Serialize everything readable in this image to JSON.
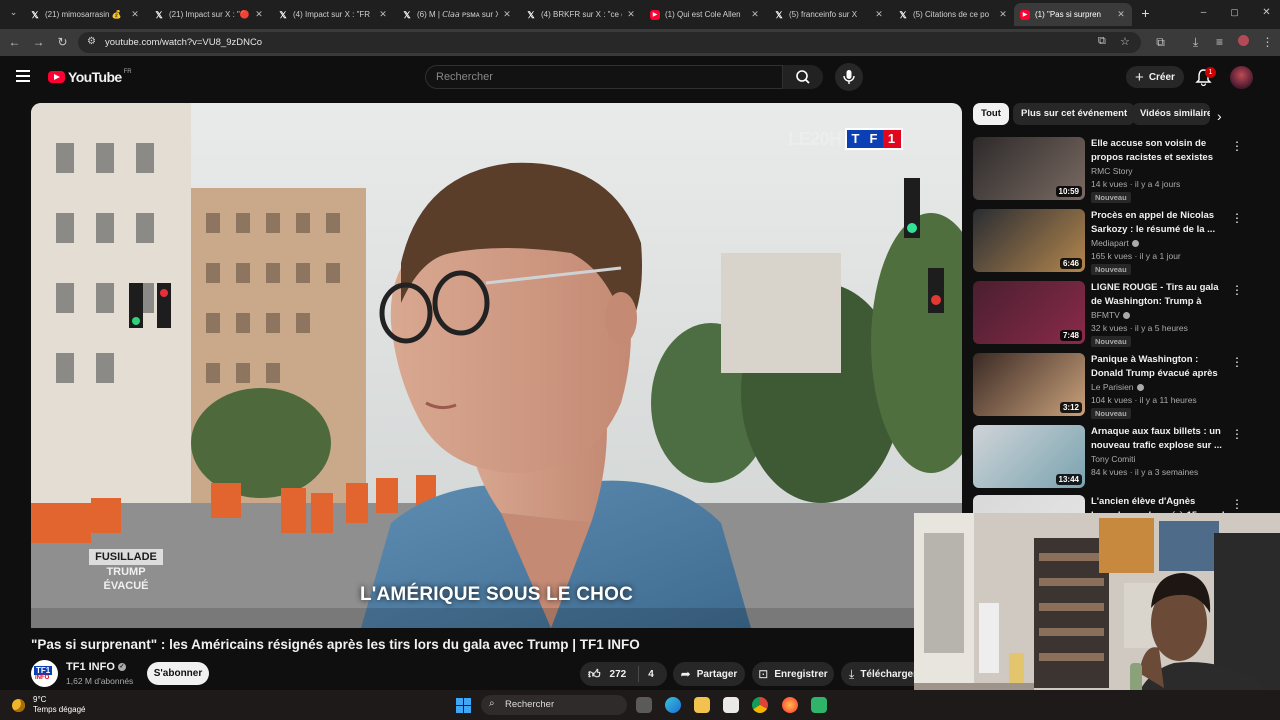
{
  "browser": {
    "tabs": [
      {
        "icon": "x",
        "title": "(21) mimosarrasin 💰"
      },
      {
        "icon": "x",
        "title": "(21) Impact sur X : \"🔴"
      },
      {
        "icon": "x",
        "title": "(4) Impact sur X : \"FR"
      },
      {
        "icon": "x",
        "title": "(6) M | 𝘊𝘭𝘢𝘢 ᴘsᴍᴀ sur X"
      },
      {
        "icon": "x",
        "title": "(4) BRKFR sur X : \"ce q"
      },
      {
        "icon": "yt",
        "title": "(1) Qui est Cole Allen"
      },
      {
        "icon": "x",
        "title": "(5) franceinfo sur X"
      },
      {
        "icon": "x",
        "title": "(5) Citations de ce po"
      },
      {
        "icon": "yt",
        "title": "(1) \"Pas si surpren"
      }
    ],
    "url": "youtube.com/watch?v=VU8_9zDNCo"
  },
  "youtube": {
    "logo_text": "YouTube",
    "country": "FR",
    "search_placeholder": "Rechercher",
    "create_label": "Créer",
    "notification_count": "1"
  },
  "video": {
    "overlay_logo_prefix": "LE20H",
    "overlay_logo_letters": [
      "T",
      "F",
      "1"
    ],
    "banner_top": "FUSILLADE",
    "banner_line1": "TRUMP",
    "banner_line2": "ÉVACUÉ",
    "caption": "L'AMÉRIQUE SOUS LE CHOC",
    "title": "\"Pas si surprenant\" : les Américains résignés après les tirs lors du gala avec Trump | TF1 INFO",
    "channel": "TF1 INFO",
    "channel_icon_top": "TF1",
    "channel_icon_bottom": "INFO",
    "subscribers": "1,62 M d'abonnés",
    "subscribe_label": "S'abonner",
    "likes": "272",
    "dislikes": "4",
    "share_label": "Partager",
    "save_label": "Enregistrer",
    "download_label": "Télécharger"
  },
  "sidebar": {
    "chips": [
      "Tout",
      "Plus sur cet événement",
      "Vidéos similaires"
    ],
    "recommendations": [
      {
        "title": "Elle accuse son voisin de propos racistes et sexistes",
        "channel": "RMC Story",
        "meta": "14 k vues · il y a 4 jours",
        "badge": "Nouveau",
        "duration": "10:59",
        "verified": false
      },
      {
        "title": "Procès en appel de Nicolas Sarkozy : le résumé de la ...",
        "channel": "Mediapart",
        "meta": "165 k vues · il y a 1 jour",
        "badge": "Nouveau",
        "duration": "6:46",
        "verified": true
      },
      {
        "title": "LIGNE ROUGE - Tirs au gala de Washington: Trump à nouveau...",
        "channel": "BFMTV",
        "meta": "32 k vues · il y a 5 heures",
        "badge": "Nouveau",
        "duration": "7:48",
        "verified": true
      },
      {
        "title": "Panique à Washington : Donald Trump évacué après des ...",
        "channel": "Le Parisien",
        "meta": "104 k vues · il y a 11 heures",
        "badge": "Nouveau",
        "duration": "3:12",
        "verified": true
      },
      {
        "title": "Arnaque aux faux billets : un nouveau trafic explose sur ...",
        "channel": "Tony Comiti",
        "meta": "84 k vues · il y a 3 semaines",
        "badge": "",
        "duration": "13:44",
        "verified": false
      },
      {
        "title": "L'ancien élève d'Agnès Lassale condamné à 15 ans de prison",
        "channel": "",
        "meta": "",
        "badge": "",
        "duration": "",
        "verified": false
      }
    ]
  },
  "taskbar": {
    "temperature": "9°C",
    "weather": "Temps dégagé",
    "search_placeholder": "Rechercher"
  },
  "colors": {
    "yt_red": "#ff0033",
    "tf1_blue": "#0a3fb5",
    "tf1_red": "#e1061e",
    "background": "#0f0f0f"
  }
}
